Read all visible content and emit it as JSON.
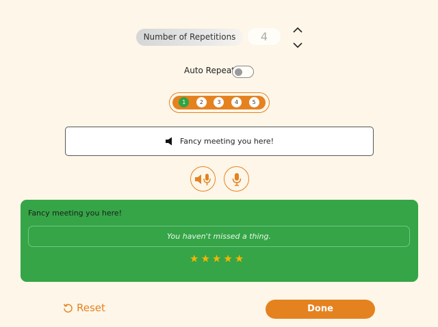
{
  "repetitions": {
    "label": "Number of Repetitions",
    "value": "4"
  },
  "auto_repeat": {
    "label": "Auto Repeat",
    "enabled": false
  },
  "steps": {
    "items": [
      "1",
      "2",
      "3",
      "4",
      "5"
    ],
    "active": "1"
  },
  "phrase": {
    "text": "Fancy meeting you here!"
  },
  "result": {
    "heard_text": "Fancy meeting you here!",
    "feedback": "You haven't missed a thing.",
    "stars": [
      "★",
      "★",
      "★",
      "★",
      "★"
    ],
    "rating": 5,
    "max_rating": 5
  },
  "actions": {
    "reset_label": "Reset",
    "done_label": "Done"
  },
  "colors": {
    "accent": "#e58220",
    "success": "#35a547",
    "background": "#fdf6e9",
    "star": "#f7b500"
  },
  "icons": {
    "increment": "chevron-up-icon",
    "decrement": "chevron-down-icon",
    "speaker": "speaker-icon",
    "listen": "speaker-mic-icon",
    "record": "microphone-icon",
    "reset": "reset-icon"
  }
}
